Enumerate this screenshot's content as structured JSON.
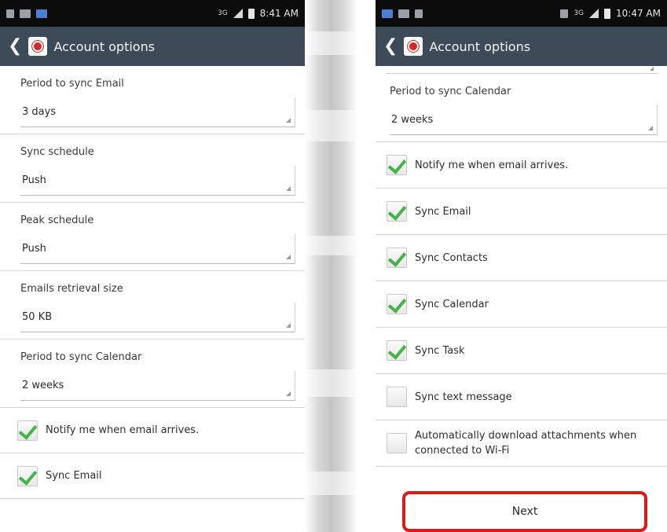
{
  "left_screen": {
    "status": {
      "time": "8:41 AM",
      "network": "3G"
    },
    "header": {
      "title": "Account options"
    },
    "settings": [
      {
        "label": "Period to sync Email",
        "value": "3 days"
      },
      {
        "label": "Sync schedule",
        "value": "Push"
      },
      {
        "label": "Peak schedule",
        "value": "Push"
      },
      {
        "label": "Emails retrieval size",
        "value": "50 KB"
      },
      {
        "label": "Period to sync Calendar",
        "value": "2 weeks"
      }
    ],
    "checkboxes": [
      {
        "label": "Notify me when email arrives.",
        "checked": true
      },
      {
        "label": "Sync Email",
        "checked": true
      }
    ]
  },
  "right_screen": {
    "status": {
      "time": "10:47 AM",
      "network": "3G"
    },
    "header": {
      "title": "Account options"
    },
    "settings": [
      {
        "label": "Period to sync Calendar",
        "value": "2 weeks"
      }
    ],
    "checkboxes": [
      {
        "label": "Notify me when email arrives.",
        "checked": true
      },
      {
        "label": "Sync Email",
        "checked": true
      },
      {
        "label": "Sync Contacts",
        "checked": true
      },
      {
        "label": "Sync Calendar",
        "checked": true
      },
      {
        "label": "Sync Task",
        "checked": true
      },
      {
        "label": "Sync text message",
        "checked": false
      },
      {
        "label": "Automatically download attachments when connected to Wi-Fi",
        "checked": false
      }
    ],
    "next_label": "Next",
    "highlight_color": "#e01818"
  },
  "colors": {
    "actionbar": "#3d4b58",
    "statusbar": "#0c0c0c",
    "check_green": "#45b347"
  }
}
